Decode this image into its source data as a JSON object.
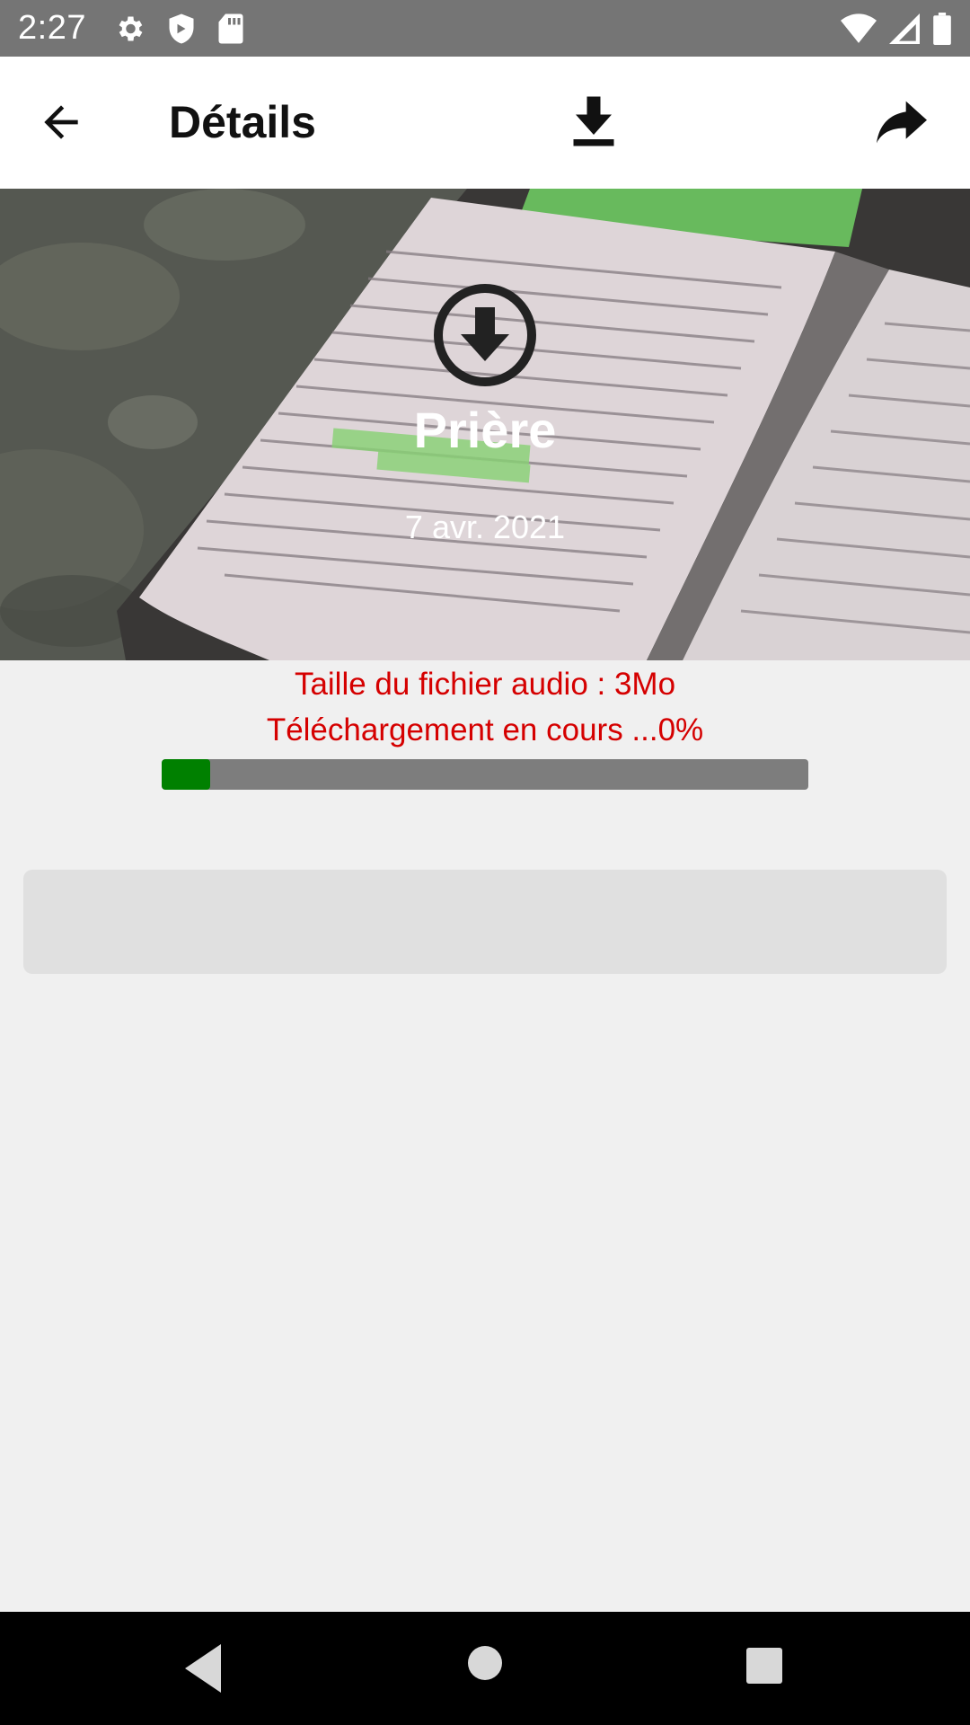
{
  "status_bar": {
    "time": "2:27",
    "icons_left": [
      "settings-icon",
      "shield-icon",
      "sd-card-icon"
    ],
    "icons_right": [
      "wifi-icon",
      "signal-icon",
      "battery-icon"
    ]
  },
  "app_bar": {
    "title": "Détails",
    "actions": [
      "back-arrow-icon",
      "download-icon",
      "share-icon"
    ]
  },
  "hero": {
    "title": "Prière",
    "date": "7 avr. 2021",
    "image_subject": "open-bible-photo"
  },
  "download": {
    "file_size_text": "Taille du fichier audio : 3Mo",
    "progress_text": "Téléchargement en cours ...0%",
    "progress_value": 0.075
  },
  "colors": {
    "status_bar": "#757575",
    "status_text": "#d50000",
    "progress_fill": "#008000",
    "progress_track": "#7d7d7d"
  }
}
